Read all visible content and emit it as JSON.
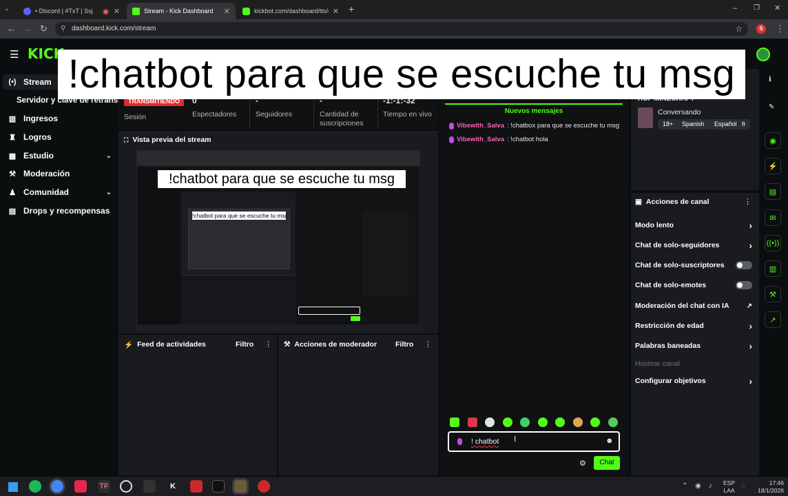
{
  "browser": {
    "tabs": [
      {
        "label": "• Discord | #TxT | Ssj"
      },
      {
        "label": "Stream - Kick Dashboard"
      },
      {
        "label": "kickbot.com/dashboard/tts/co"
      }
    ],
    "url": "dashboard.kick.com/stream",
    "profile_initial": "S"
  },
  "overlay": {
    "caption": "!chatbot para que se escuche tu msg"
  },
  "sidebar": {
    "items": [
      {
        "label": "Stream"
      },
      {
        "label": "Servidor y clave de retransm"
      },
      {
        "label": "Ingresos"
      },
      {
        "label": "Logros"
      },
      {
        "label": "Estudio"
      },
      {
        "label": "Moderación"
      },
      {
        "label": "Comunidad"
      },
      {
        "label": "Drops y recompensas"
      }
    ]
  },
  "session": {
    "status_badge": "TRANSMITIENDO",
    "session_label": "Sesión",
    "viewers_value": "0",
    "viewers_label": "Espectadores",
    "followers_value": "-",
    "followers_label": "Seguidores",
    "subs_value": "-",
    "subs_label": "Cantidad de suscripciones",
    "uptime_value": "-1:-1:-32",
    "uptime_label": "Tiempo en vivo"
  },
  "preview": {
    "title": "Vista previa del stream",
    "inner_caption": "!chatbot para que se escuche tu msg",
    "inner_caption_small": "!chatbot para que se escuche tu msg"
  },
  "activity_feed": {
    "title": "Feed de actividades",
    "filter": "Filtro"
  },
  "mod_actions": {
    "title": "Acciones de moderador",
    "filter": "Filtro"
  },
  "chat": {
    "new_messages": "Nuevos mensajes",
    "messages": [
      {
        "user": "Vibewith_Salva",
        "text": ": !chatbox para que se escuche tu msg"
      },
      {
        "user": "Vibewith_Salva",
        "text": ": !chatbot hola"
      }
    ],
    "input_value": "! chatbot",
    "send_label": "Chat"
  },
  "stream_info": {
    "title": "HCF MINECRAFT",
    "category": "Conversando",
    "tags": [
      "18+",
      "Spanish",
      "Español",
      "fr"
    ]
  },
  "channel_actions": {
    "title": "Acciones de canal",
    "rows": [
      {
        "label": "Modo lento"
      },
      {
        "label": "Chat de solo-seguidores"
      },
      {
        "label": "Chat de solo-suscriptores"
      },
      {
        "label": "Chat de solo-emotes"
      },
      {
        "label": "Moderación del chat con IA"
      },
      {
        "label": "Restricción de edad"
      },
      {
        "label": "Palabras baneadas"
      },
      {
        "label": "Hostear canal"
      },
      {
        "label": "Configurar objetivos"
      }
    ]
  },
  "taskbar": {
    "lang": "ESP",
    "region": "LAA",
    "time": "17:46",
    "date": "18/1/2026"
  },
  "colors": {
    "kick_green": "#53fc18",
    "live_red": "#e22b2b",
    "username_pink": "#ff5fb6"
  }
}
